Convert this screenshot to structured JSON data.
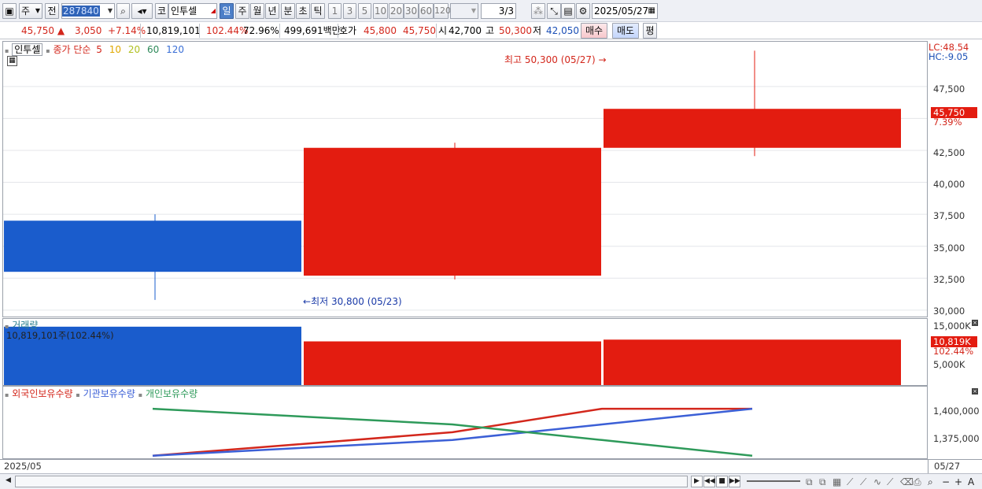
{
  "toolbar": {
    "period_mode": "주",
    "all_label": "전",
    "code": "287840",
    "market": "코",
    "stock_name": "인투셀",
    "period_buttons": [
      "일",
      "주",
      "월",
      "년",
      "분",
      "초",
      "틱"
    ],
    "selected_period": "일",
    "intervals": [
      "1",
      "3",
      "5",
      "10",
      "20",
      "30",
      "60",
      "120"
    ],
    "page_counter": "3/3",
    "date": "2025/05/27"
  },
  "quote": {
    "price": "45,750",
    "change": "3,050",
    "change_pct": "+7.14%",
    "volume": "10,819,101",
    "volume_ratio": "102.44%",
    "turnover": "72.96%",
    "amount": "499,691백만",
    "bid_label": "호가",
    "bid": "45,800",
    "ask": "45,750",
    "open_label": "시",
    "open": "42,700",
    "high_label": "고",
    "high": "50,300",
    "low_label": "저",
    "low": "42,050",
    "buy_label": "매수",
    "sell_label": "매도",
    "avg_label": "평"
  },
  "colors": {
    "up": "#e31c10",
    "down": "#1a5ccc",
    "foreign": "#d3271c",
    "institution": "#3b5fd6",
    "individual": "#2e9a5a"
  },
  "price_pane": {
    "legend_name": "인투셀",
    "legend_ma_title": "종가 단순",
    "ma_periods": [
      "5",
      "10",
      "20",
      "60",
      "120"
    ],
    "ma_colors": [
      "#d3271c",
      "#e0a800",
      "#b0c020",
      "#2e8a5a",
      "#3a6fd6"
    ],
    "lc": "LC:48.54",
    "hc": "HC:-9.05",
    "current_price_tag": "45,750",
    "current_change_tag": "7.39%",
    "high_annotation": "최고 50,300 (05/27)",
    "low_annotation": "최저 30,800 (05/23)",
    "y_ticks": [
      "47,500",
      "45,000",
      "42,500",
      "40,000",
      "37,500",
      "35,000",
      "32,500",
      "30,000"
    ]
  },
  "volume_pane": {
    "title": "거래량",
    "reading": "10,819,101주(102.44%)",
    "tag_value": "10,819K",
    "tag_pct": "102.44%",
    "y_ticks": [
      "15,000K",
      "5,000K"
    ]
  },
  "holdings_pane": {
    "legend": [
      "외국인보유수량",
      "기관보유수량",
      "개인보유수량"
    ],
    "y_ticks": [
      "1,400,000",
      "1,375,000"
    ]
  },
  "x_axis": {
    "start_label": "2025/05",
    "end_label": "05/27"
  },
  "chart_data": [
    {
      "type": "candlestick",
      "ylim": [
        29500,
        51000
      ],
      "candles": [
        {
          "open": 37000,
          "high": 37500,
          "low": 30800,
          "close": 33000,
          "color": "down"
        },
        {
          "open": 32700,
          "high": 43100,
          "low": 32400,
          "close": 42700,
          "color": "up"
        },
        {
          "open": 42700,
          "high": 50300,
          "low": 42050,
          "close": 45750,
          "color": "up"
        }
      ]
    },
    {
      "type": "bar",
      "ylim": [
        0,
        15000
      ],
      "unit": "K",
      "values": [
        13900,
        10400,
        10819
      ]
    },
    {
      "type": "line",
      "ylim": [
        1360000,
        1415000
      ],
      "x": [
        1,
        2,
        3,
        4
      ],
      "series": [
        {
          "name": "외국인보유수량",
          "values": [
            1362000,
            1380000,
            1398000,
            1398000
          ]
        },
        {
          "name": "기관보유수량",
          "values": [
            1362000,
            1374000,
            1386000,
            1398000
          ]
        },
        {
          "name": "개인보유수량",
          "values": [
            1398000,
            1386000,
            1374000,
            1362000
          ]
        }
      ]
    }
  ]
}
